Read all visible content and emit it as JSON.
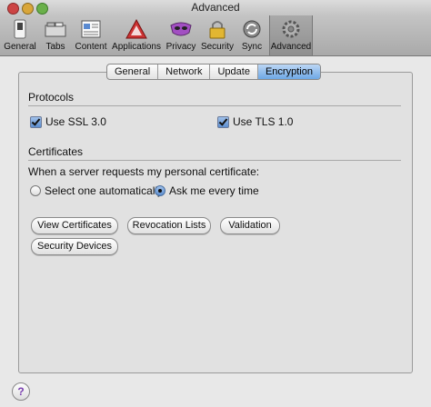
{
  "window": {
    "title": "Advanced"
  },
  "toolbar": {
    "items": [
      {
        "label": "General",
        "icon": "switch-icon"
      },
      {
        "label": "Tabs",
        "icon": "tabs-icon"
      },
      {
        "label": "Content",
        "icon": "content-icon"
      },
      {
        "label": "Applications",
        "icon": "applications-icon"
      },
      {
        "label": "Privacy",
        "icon": "mask-icon"
      },
      {
        "label": "Security",
        "icon": "lock-icon"
      },
      {
        "label": "Sync",
        "icon": "sync-icon"
      },
      {
        "label": "Advanced",
        "icon": "gear-icon"
      }
    ]
  },
  "tabs": [
    {
      "label": "General"
    },
    {
      "label": "Network"
    },
    {
      "label": "Update"
    },
    {
      "label": "Encryption"
    }
  ],
  "protocols": {
    "title": "Protocols",
    "ssl_label": "Use SSL 3.0",
    "tls_label": "Use TLS 1.0"
  },
  "certificates": {
    "title": "Certificates",
    "prompt": "When a server requests my personal certificate:",
    "option_auto": "Select one automatically",
    "option_ask": "Ask me every time"
  },
  "buttons": {
    "view_certificates": "View Certificates",
    "revocation_lists": "Revocation Lists",
    "validation": "Validation",
    "security_devices": "Security Devices"
  },
  "help": {
    "label": "?"
  }
}
